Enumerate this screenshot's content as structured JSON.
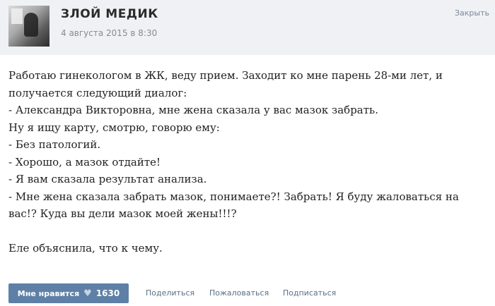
{
  "post": {
    "author": "ЗЛОЙ МЕДИК",
    "date": "4 августа 2015 в 8:30",
    "close_label": "Закрыть",
    "lines": [
      "Работаю гинекологом в ЖК, веду прием. Заходит ко мне парень 28-ми лет, и",
      "получается следующий диалог:",
      "- Александра Викторовна, мне жена сказала у вас мазок забрать.",
      "Ну я ищу карту, смотрю, говорю ему:",
      "- Без патологий.",
      "- Хорошо, а мазок отдайте!",
      "- Я вам сказала результат анализа.",
      "- Мне жена сказала забрать мазок, понимаете?! Забрать! Я буду жаловаться на",
      "вас!? Куда вы дели мазок моей жены!!!?"
    ],
    "closing": "Еле объяснила, что к чему."
  },
  "footer": {
    "like_label": "Мне нравится",
    "heart_icon": "heart-icon",
    "like_count": "1630",
    "share_label": "Поделиться",
    "report_label": "Пожаловаться",
    "subscribe_label": "Подписаться"
  }
}
